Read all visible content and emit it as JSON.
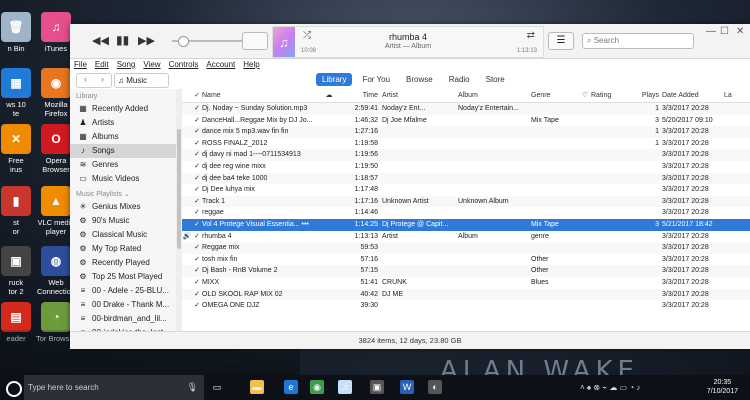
{
  "desktop": {
    "icons": [
      {
        "label": "n Bin",
        "color": "#9fb4c8",
        "glyph": "🗑"
      },
      {
        "label": "iTunes",
        "color": "#e44f8c",
        "glyph": "♫"
      },
      {
        "label": "ws 10\nte",
        "color": "#1f7bd6",
        "glyph": "▦"
      },
      {
        "label": "Mozilla\nFirefox",
        "color": "#e8761e",
        "glyph": "◉"
      },
      {
        "label": "Free\nirus",
        "color": "#f08a00",
        "glyph": "✕"
      },
      {
        "label": "Opera\nBrowser",
        "color": "#d01a21",
        "glyph": "O"
      },
      {
        "label": "st\nor",
        "color": "#c8372d",
        "glyph": "▮"
      },
      {
        "label": "VLC media\nplayer",
        "color": "#f08c00",
        "glyph": "▲"
      },
      {
        "label": "ruck\ntor 2",
        "color": "#444",
        "glyph": "▣"
      },
      {
        "label": "Web\nConnection",
        "color": "#2d4e9a",
        "glyph": "◍"
      },
      {
        "label": "eader",
        "color": "#d42a1c",
        "glyph": "▤"
      },
      {
        "label": "Tor Browser",
        "color": "#6d9b3c",
        "glyph": "◔"
      }
    ],
    "wallpaper_text": "ALAN WAKE"
  },
  "player": {
    "prev": "◀◀",
    "play": "▮▮",
    "next": "▶▶",
    "track_title": "rhumba 4",
    "track_sub": "Artist — Album",
    "time_elapsed": "10:09",
    "time_remaining": "1:13:13",
    "search_placeholder": "Search"
  },
  "window_controls": [
    "—",
    "☐",
    "✕"
  ],
  "menu": [
    "File",
    "Edit",
    "Song",
    "View",
    "Controls",
    "Account",
    "Help"
  ],
  "media_selector": "Music",
  "tabs": [
    {
      "label": "Library",
      "active": true
    },
    {
      "label": "For You",
      "active": false
    },
    {
      "label": "Browse",
      "active": false
    },
    {
      "label": "Radio",
      "active": false
    },
    {
      "label": "Store",
      "active": false
    }
  ],
  "sidebar": {
    "library_heading": "Library",
    "library_items": [
      {
        "label": "Recently Added",
        "icon": "▦",
        "selected": false
      },
      {
        "label": "Artists",
        "icon": "♟",
        "selected": false
      },
      {
        "label": "Albums",
        "icon": "▦",
        "selected": false
      },
      {
        "label": "Songs",
        "icon": "♪",
        "selected": true
      },
      {
        "label": "Genres",
        "icon": "≋",
        "selected": false
      },
      {
        "label": "Music Videos",
        "icon": "▭",
        "selected": false
      }
    ],
    "playlists_heading": "Music Playlists ⌄",
    "playlists": [
      {
        "label": "Genius Mixes",
        "icon": "✳"
      },
      {
        "label": "90's Music",
        "icon": "⚙"
      },
      {
        "label": "Classical Music",
        "icon": "⚙"
      },
      {
        "label": "My Top Rated",
        "icon": "⚙"
      },
      {
        "label": "Recently Played",
        "icon": "⚙"
      },
      {
        "label": "Top 25 Most Played",
        "icon": "⚙"
      },
      {
        "label": "00 - Adele - 25-BLU...",
        "icon": "≡"
      },
      {
        "label": "00 Drake - Thank M...",
        "icon": "≡"
      },
      {
        "label": "00-birdman_and_lil...",
        "icon": "≡"
      },
      {
        "label": "00-jadakiss-the_last...",
        "icon": "≡"
      }
    ]
  },
  "columns": {
    "name": "Name",
    "time": "Time",
    "artist": "Artist",
    "album": "Album",
    "genre": "Genre",
    "heart": "♡",
    "rating": "Rating",
    "plays": "Plays",
    "date_added": "Date Added",
    "last": "La"
  },
  "songs": [
    {
      "name": "Dj. Noday ~ Sunday Solution.mp3",
      "time": "2:59:41",
      "artist": "Noday'z  Ent...",
      "album": "Noday'z  Entertain...",
      "genre": "",
      "plays": "1",
      "date": "3/3/2017 20:28",
      "playing": false,
      "selected": false
    },
    {
      "name": "DanceHall...Reggae Mix by DJ Jo...",
      "time": "1:46:32",
      "artist": "Dj Joe Mfalme",
      "album": "",
      "genre": "Mix Tape",
      "plays": "3",
      "date": "5/20/2017 09:10",
      "playing": false,
      "selected": false
    },
    {
      "name": "dance mix 5 mp3.wav fin fin",
      "time": "1:27:16",
      "artist": "",
      "album": "",
      "genre": "",
      "plays": "1",
      "date": "3/3/2017 20:28",
      "playing": false,
      "selected": false
    },
    {
      "name": "ROSS FINALZ_2012",
      "time": "1:19:58",
      "artist": "",
      "album": "",
      "genre": "",
      "plays": "1",
      "date": "3/3/2017 20:28",
      "playing": false,
      "selected": false
    },
    {
      "name": "dj davy ni mad 1----0711534913",
      "time": "1:19:56",
      "artist": "",
      "album": "",
      "genre": "",
      "plays": "",
      "date": "3/3/2017 20:28",
      "playing": false,
      "selected": false
    },
    {
      "name": "dj dee reg wine mixx",
      "time": "1:19:50",
      "artist": "",
      "album": "",
      "genre": "",
      "plays": "",
      "date": "3/3/2017 20:28",
      "playing": false,
      "selected": false
    },
    {
      "name": "dj dee ba4 teke 1000",
      "time": "1:18:57",
      "artist": "",
      "album": "",
      "genre": "",
      "plays": "",
      "date": "3/3/2017 20:28",
      "playing": false,
      "selected": false
    },
    {
      "name": "Dj Dee luhya mix",
      "time": "1:17:48",
      "artist": "",
      "album": "",
      "genre": "",
      "plays": "",
      "date": "3/3/2017 20:28",
      "playing": false,
      "selected": false
    },
    {
      "name": "Track 1",
      "time": "1:17:16",
      "artist": "Unknown Artist",
      "album": "Unknown Album",
      "genre": "",
      "plays": "",
      "date": "3/3/2017 20:28",
      "playing": false,
      "selected": false
    },
    {
      "name": "reggae",
      "time": "1:14:46",
      "artist": "",
      "album": "",
      "genre": "",
      "plays": "",
      "date": "3/3/2017 20:28",
      "playing": false,
      "selected": false
    },
    {
      "name": "Vol 4 Protege Visual Essentia...  •••",
      "time": "1:14:25",
      "artist": "Dj Protege @ Capit...",
      "album": "",
      "genre": "Mix Tape",
      "plays": "3",
      "date": "5/21/2017 18:42",
      "playing": false,
      "selected": true
    },
    {
      "name": "rhumba 4",
      "time": "1:13:13",
      "artist": "Artist",
      "album": "Album",
      "genre": "genre",
      "plays": "",
      "date": "3/3/2017 20:28",
      "playing": true,
      "selected": false
    },
    {
      "name": "Reggae mix",
      "time": "59:53",
      "artist": "",
      "album": "",
      "genre": "",
      "plays": "",
      "date": "3/3/2017 20:28",
      "playing": false,
      "selected": false
    },
    {
      "name": "tosh mix fin",
      "time": "57:16",
      "artist": "",
      "album": "",
      "genre": "Other",
      "plays": "",
      "date": "3/3/2017 20:28",
      "playing": false,
      "selected": false
    },
    {
      "name": "Dj Bash - RnB Volume 2",
      "time": "57:15",
      "artist": "",
      "album": "",
      "genre": "Other",
      "plays": "",
      "date": "3/3/2017 20:28",
      "playing": false,
      "selected": false
    },
    {
      "name": "MIXX",
      "time": "51:41",
      "artist": "CRUNK",
      "album": "",
      "genre": "Blues",
      "plays": "",
      "date": "3/3/2017 20:28",
      "playing": false,
      "selected": false
    },
    {
      "name": "OLD SKOOL RAP MIX 02",
      "time": "40:42",
      "artist": "DJ ME",
      "album": "",
      "genre": "",
      "plays": "",
      "date": "3/3/2017 20:28",
      "playing": false,
      "selected": false
    },
    {
      "name": "OMEGA ONE DJZ",
      "time": "39:30",
      "artist": "",
      "album": "",
      "genre": "",
      "plays": "",
      "date": "3/3/2017 20:28",
      "playing": false,
      "selected": false
    }
  ],
  "status": "3824 items, 12 days, 23.80 GB",
  "taskbar": {
    "search_placeholder": "Type here to search",
    "apps": [
      {
        "name": "task-view-icon",
        "glyph": "▭",
        "color": "#0d1117"
      },
      {
        "name": "file-explorer-icon",
        "glyph": "▬",
        "color": "#f4c04a"
      },
      {
        "name": "edge-icon",
        "glyph": "e",
        "color": "#1e78d0"
      },
      {
        "name": "chrome-icon",
        "glyph": "◉",
        "color": "#3b9e4a"
      },
      {
        "name": "itunes-icon",
        "glyph": "♫",
        "color": "#c9dff7"
      },
      {
        "name": "store-icon",
        "glyph": "▣",
        "color": "#555"
      },
      {
        "name": "word-icon",
        "glyph": "W",
        "color": "#2b5fb2"
      },
      {
        "name": "torch-icon",
        "glyph": "◐",
        "color": "#555"
      }
    ],
    "time": "20:35",
    "date": "7/10/2017"
  }
}
